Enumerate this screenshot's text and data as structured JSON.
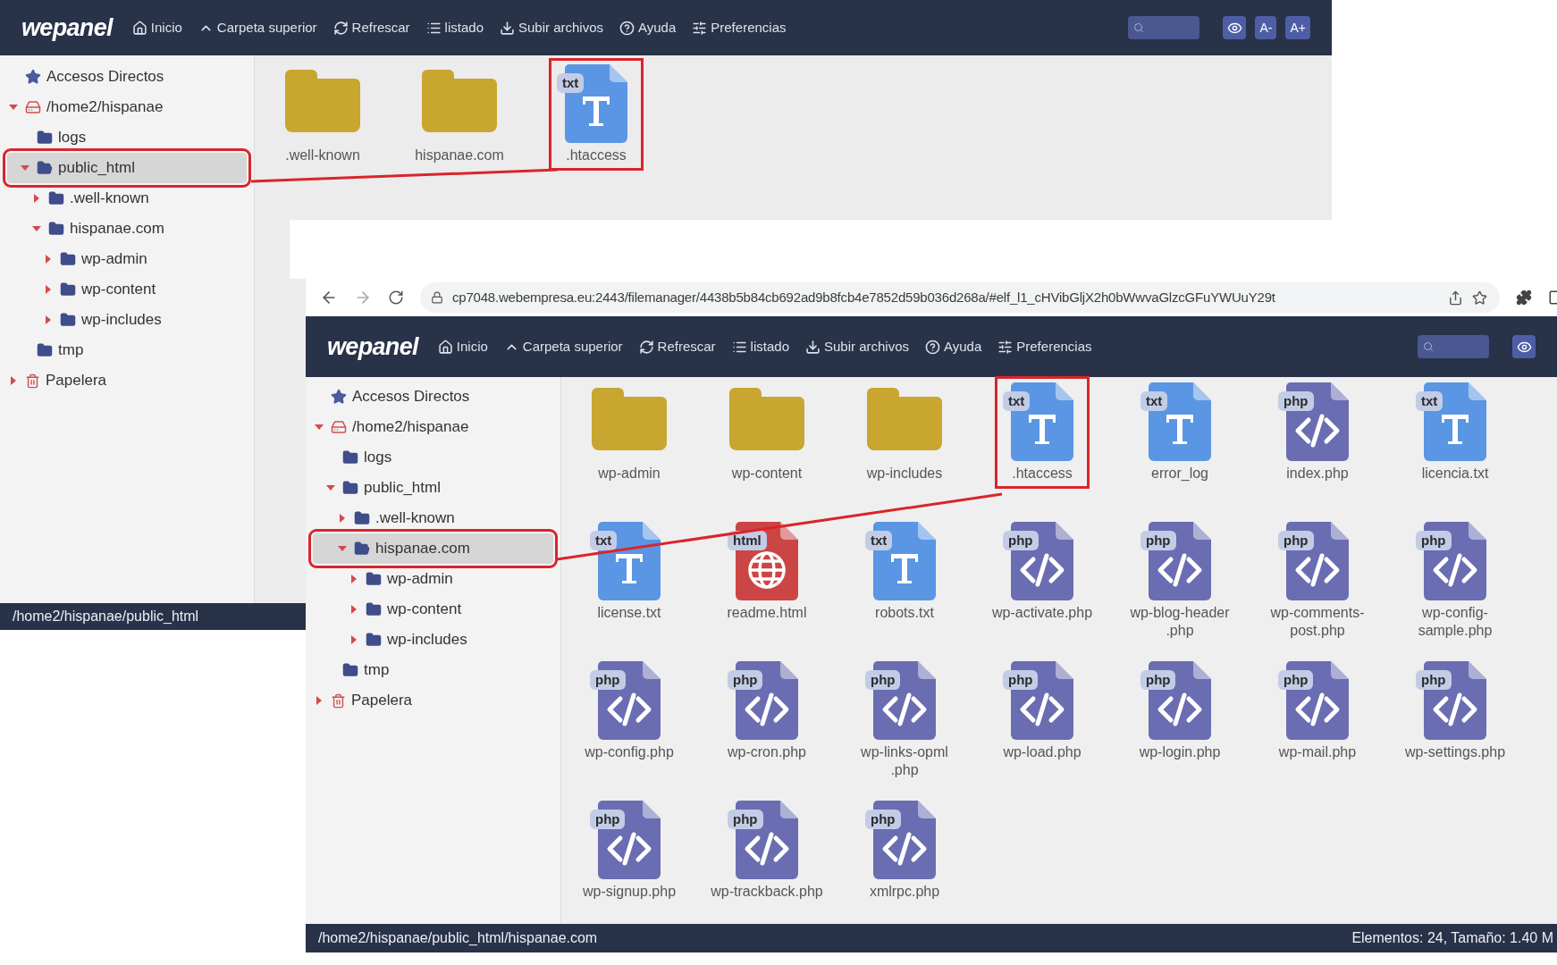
{
  "screenshots": [
    {
      "toolbar": {
        "logo": "wepanel",
        "items": [
          {
            "kind": "home",
            "label": "Inicio"
          },
          {
            "kind": "up",
            "label": "Carpeta superior"
          },
          {
            "kind": "refresh",
            "label": "Refrescar"
          },
          {
            "kind": "list",
            "label": "listado"
          },
          {
            "kind": "upload",
            "label": "Subir archivos"
          },
          {
            "kind": "help",
            "label": "Ayuda"
          },
          {
            "kind": "prefs",
            "label": "Preferencias"
          }
        ],
        "controls": [
          {
            "kind": "search"
          },
          {
            "kind": "eye"
          },
          {
            "kind": "text",
            "label": "A-"
          },
          {
            "kind": "text",
            "label": "A+"
          }
        ]
      },
      "tree": [
        {
          "label": "Accesos Directos",
          "kind": "star",
          "selected": false,
          "annotated": false
        },
        {
          "label": "/home2/hispanae",
          "kind": "drive",
          "expanded": true,
          "selected": false,
          "annotated": false,
          "children": [
            {
              "label": "logs",
              "kind": "folder",
              "selected": false,
              "annotated": false
            },
            {
              "label": "public_html",
              "kind": "folder",
              "expanded": true,
              "selected": true,
              "annotated": true,
              "children": [
                {
                  "label": ".well-known",
                  "kind": "folder",
                  "expanded": false,
                  "selected": false,
                  "annotated": false
                },
                {
                  "label": "hispanae.com",
                  "kind": "folder",
                  "expanded": true,
                  "selected": false,
                  "annotated": false,
                  "children": [
                    {
                      "label": "wp-admin",
                      "kind": "folder",
                      "expanded": false,
                      "selected": false,
                      "annotated": false
                    },
                    {
                      "label": "wp-content",
                      "kind": "folder",
                      "expanded": false,
                      "selected": false,
                      "annotated": false
                    },
                    {
                      "label": "wp-includes",
                      "kind": "folder",
                      "expanded": false,
                      "selected": false,
                      "annotated": false
                    }
                  ]
                }
              ]
            },
            {
              "label": "tmp",
              "kind": "folder",
              "selected": false,
              "annotated": false
            }
          ]
        },
        {
          "label": "Papelera",
          "kind": "trash",
          "expanded": false,
          "selected": false,
          "annotated": false
        }
      ],
      "files": [
        {
          "name": ".well-known",
          "kind": "folder",
          "annotated": false
        },
        {
          "name": "hispanae.com",
          "kind": "folder",
          "annotated": false
        },
        {
          "name": ".htaccess",
          "kind": "txt",
          "badge": "txt",
          "annotated": true
        }
      ],
      "status_bar": {
        "path": "/home2/hispanae/public_html"
      }
    },
    {
      "browser": {
        "url": "cp7048.webempresa.eu:2443/filemanager/4438b5b84cb692ad9b8fcb4e7852d59b036d268a/#elf_l1_cHVibGljX2h0bWwvaGlzcGFuYWUuY29t"
      },
      "toolbar": {
        "logo": "wepanel",
        "items": [
          {
            "kind": "home",
            "label": "Inicio"
          },
          {
            "kind": "up",
            "label": "Carpeta superior"
          },
          {
            "kind": "refresh",
            "label": "Refrescar"
          },
          {
            "kind": "list",
            "label": "listado"
          },
          {
            "kind": "upload",
            "label": "Subir archivos"
          },
          {
            "kind": "help",
            "label": "Ayuda"
          },
          {
            "kind": "prefs",
            "label": "Preferencias"
          }
        ],
        "controls": [
          {
            "kind": "search"
          },
          {
            "kind": "eye"
          }
        ]
      },
      "tree": [
        {
          "label": "Accesos Directos",
          "kind": "star",
          "selected": false,
          "annotated": false
        },
        {
          "label": "/home2/hispanae",
          "kind": "drive",
          "expanded": true,
          "selected": false,
          "annotated": false,
          "children": [
            {
              "label": "logs",
              "kind": "folder",
              "selected": false,
              "annotated": false
            },
            {
              "label": "public_html",
              "kind": "folder",
              "expanded": true,
              "selected": false,
              "annotated": false,
              "children": [
                {
                  "label": ".well-known",
                  "kind": "folder",
                  "expanded": false,
                  "selected": false,
                  "annotated": false
                },
                {
                  "label": "hispanae.com",
                  "kind": "folder",
                  "expanded": true,
                  "selected": true,
                  "annotated": true,
                  "children": [
                    {
                      "label": "wp-admin",
                      "kind": "folder",
                      "expanded": false,
                      "selected": false,
                      "annotated": false
                    },
                    {
                      "label": "wp-content",
                      "kind": "folder",
                      "expanded": false,
                      "selected": false,
                      "annotated": false
                    },
                    {
                      "label": "wp-includes",
                      "kind": "folder",
                      "expanded": false,
                      "selected": false,
                      "annotated": false
                    }
                  ]
                }
              ]
            },
            {
              "label": "tmp",
              "kind": "folder",
              "selected": false,
              "annotated": false
            }
          ]
        },
        {
          "label": "Papelera",
          "kind": "trash",
          "expanded": false,
          "selected": false,
          "annotated": false
        }
      ],
      "files": [
        {
          "name": "wp-admin",
          "kind": "folder",
          "annotated": false
        },
        {
          "name": "wp-content",
          "kind": "folder",
          "annotated": false
        },
        {
          "name": "wp-includes",
          "kind": "folder",
          "annotated": false
        },
        {
          "name": ".htaccess",
          "kind": "txt",
          "badge": "txt",
          "annotated": true
        },
        {
          "name": "error_log",
          "kind": "txt",
          "badge": "txt",
          "annotated": false
        },
        {
          "name": "index.php",
          "kind": "php",
          "badge": "php",
          "annotated": false
        },
        {
          "name": "licencia.txt",
          "kind": "txt",
          "badge": "txt",
          "annotated": false
        },
        {
          "name": "license.txt",
          "kind": "txt",
          "badge": "txt",
          "annotated": false
        },
        {
          "name": "readme.html",
          "kind": "html",
          "badge": "html",
          "annotated": false
        },
        {
          "name": "robots.txt",
          "kind": "txt",
          "badge": "txt",
          "annotated": false
        },
        {
          "name": "wp-activate.php",
          "kind": "php",
          "badge": "php",
          "annotated": false
        },
        {
          "name": "wp-blog-header\n.php",
          "kind": "php",
          "badge": "php",
          "annotated": false
        },
        {
          "name": "wp-comments-\npost.php",
          "kind": "php",
          "badge": "php",
          "annotated": false
        },
        {
          "name": "wp-config-\nsample.php",
          "kind": "php",
          "badge": "php",
          "annotated": false
        },
        {
          "name": "wp-config.php",
          "kind": "php",
          "badge": "php",
          "annotated": false
        },
        {
          "name": "wp-cron.php",
          "kind": "php",
          "badge": "php",
          "annotated": false
        },
        {
          "name": "wp-links-opml\n.php",
          "kind": "php",
          "badge": "php",
          "annotated": false
        },
        {
          "name": "wp-load.php",
          "kind": "php",
          "badge": "php",
          "annotated": false
        },
        {
          "name": "wp-login.php",
          "kind": "php",
          "badge": "php",
          "annotated": false
        },
        {
          "name": "wp-mail.php",
          "kind": "php",
          "badge": "php",
          "annotated": false
        },
        {
          "name": "wp-settings.php",
          "kind": "php",
          "badge": "php",
          "annotated": false
        },
        {
          "name": "wp-signup.php",
          "kind": "php",
          "badge": "php",
          "annotated": false
        },
        {
          "name": "wp-trackback.php",
          "kind": "php",
          "badge": "php",
          "annotated": false
        },
        {
          "name": "xmlrpc.php",
          "kind": "php",
          "badge": "php",
          "annotated": false
        }
      ],
      "status_bar": {
        "path": "/home2/hispanae/public_html/hispanae.com",
        "info": "Elementos: 24, Tamaño: 1.40 M"
      }
    }
  ]
}
